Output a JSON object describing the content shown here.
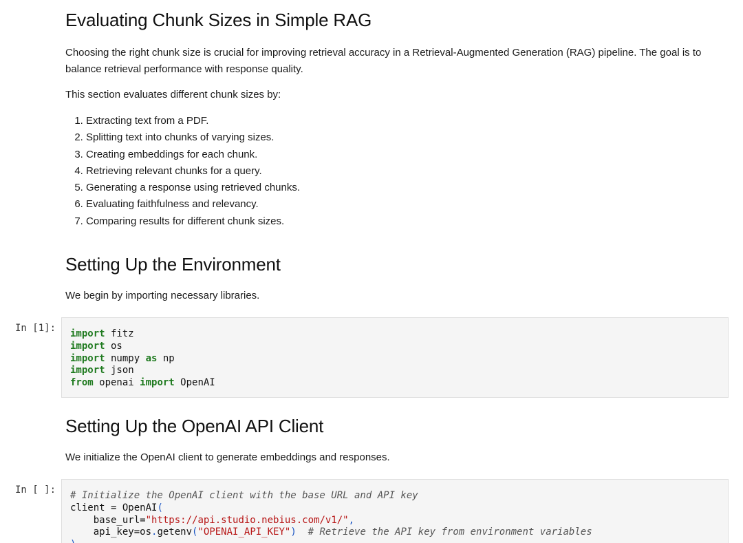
{
  "section1": {
    "title": "Evaluating Chunk Sizes in Simple RAG",
    "intro": "Choosing the right chunk size is crucial for improving retrieval accuracy in a Retrieval-Augmented Generation (RAG) pipeline. The goal is to balance retrieval performance with response quality.",
    "lead": "This section evaluates different chunk sizes by:",
    "steps": [
      "Extracting text from a PDF.",
      "Splitting text into chunks of varying sizes.",
      "Creating embeddings for each chunk.",
      "Retrieving relevant chunks for a query.",
      "Generating a response using retrieved chunks.",
      "Evaluating faithfulness and relevancy.",
      "Comparing results for different chunk sizes."
    ]
  },
  "section2": {
    "title": "Setting Up the Environment",
    "desc": "We begin by importing necessary libraries."
  },
  "cell1": {
    "prompt": "In [1]:",
    "code": {
      "l1_kw": "import",
      "l1_rest": " fitz",
      "l2_kw": "import",
      "l2_rest": " os",
      "l3_kw": "import",
      "l3_mid": " numpy ",
      "l3_kw2": "as",
      "l3_rest": " np",
      "l4_kw": "import",
      "l4_rest": " json",
      "l5_kw": "from",
      "l5_mid": " openai ",
      "l5_kw2": "import",
      "l5_rest": " OpenAI"
    }
  },
  "section3": {
    "title": "Setting Up the OpenAI API Client",
    "desc": "We initialize the OpenAI client to generate embeddings and responses."
  },
  "cell2": {
    "prompt": "In [ ]:",
    "code": {
      "l1_comment": "# Initialize the OpenAI client with the base URL and API key",
      "l2_a": "client ",
      "l2_op": "=",
      "l2_b": " OpenAI",
      "l2_paren": "(",
      "l3_a": "    base_url",
      "l3_op": "=",
      "l3_str": "\"https://api.studio.nebius.com/v1/\"",
      "l3_comma": ",",
      "l4_a": "    api_key",
      "l4_op": "=",
      "l4_b": "os",
      "l4_dot": ".",
      "l4_c": "getenv",
      "l4_p1": "(",
      "l4_str": "\"OPENAI_API_KEY\"",
      "l4_p2": ")",
      "l4_comment": "  # Retrieve the API key from environment variables",
      "l5_paren": ")"
    }
  }
}
